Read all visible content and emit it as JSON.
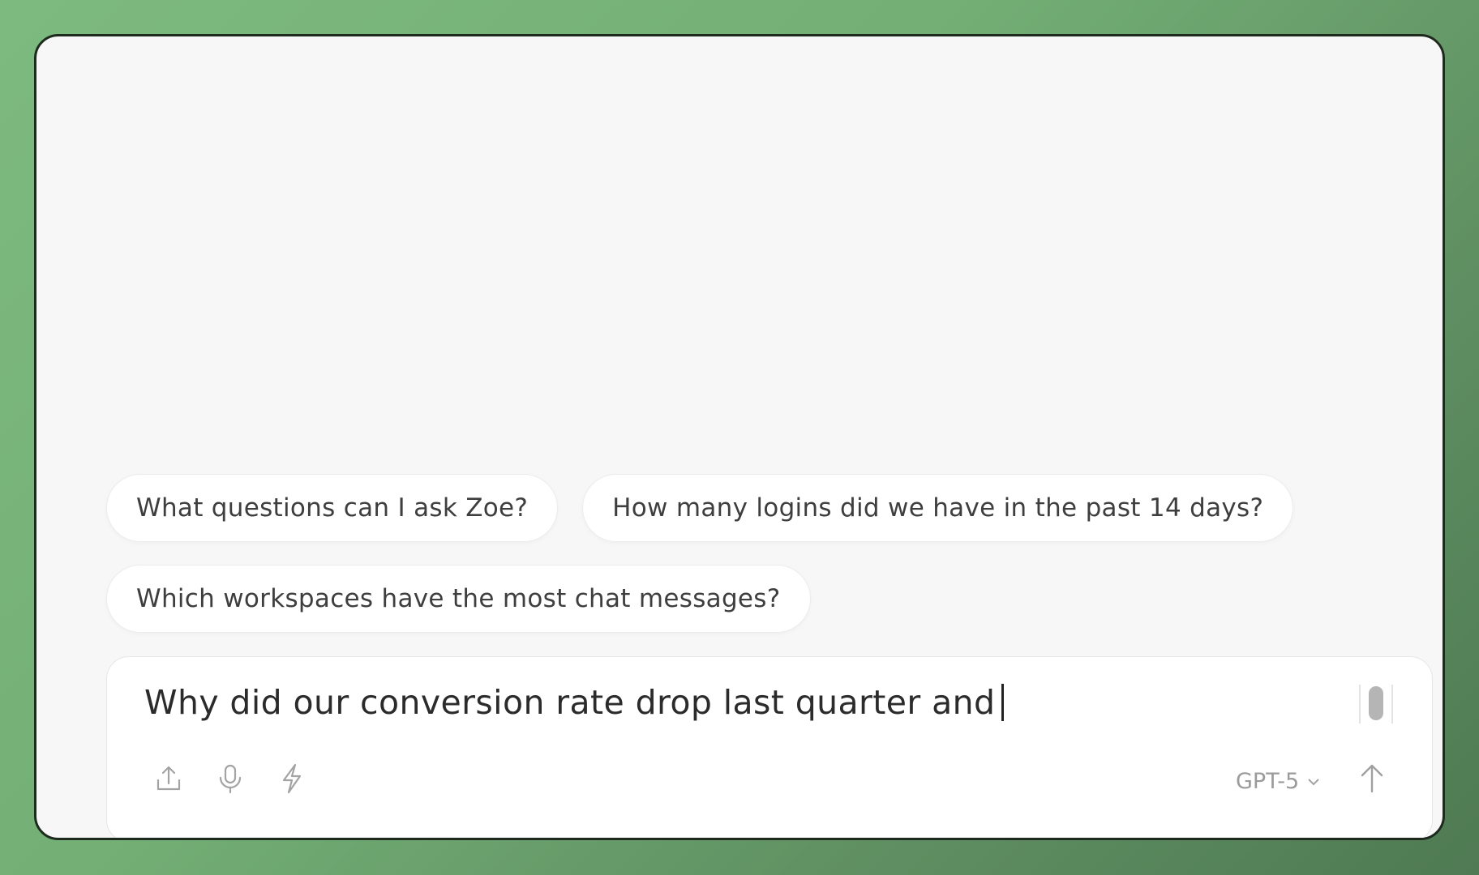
{
  "suggestions": [
    {
      "label": "What questions can I ask Zoe?"
    },
    {
      "label": "How many logins did we have in the past 14 days?"
    },
    {
      "label": "Which workspaces have the most chat messages?"
    }
  ],
  "composer": {
    "input_value": "Why did our conversion rate drop last quarter and",
    "model_label": "GPT-5",
    "icons": {
      "upload": "upload-icon",
      "mic": "microphone-icon",
      "lightning": "lightning-icon",
      "chevron": "chevron-down-icon",
      "send": "arrow-up-icon"
    }
  },
  "colors": {
    "background_green": "#7dba7f",
    "panel": "#f7f7f7",
    "chip": "#ffffff"
  }
}
